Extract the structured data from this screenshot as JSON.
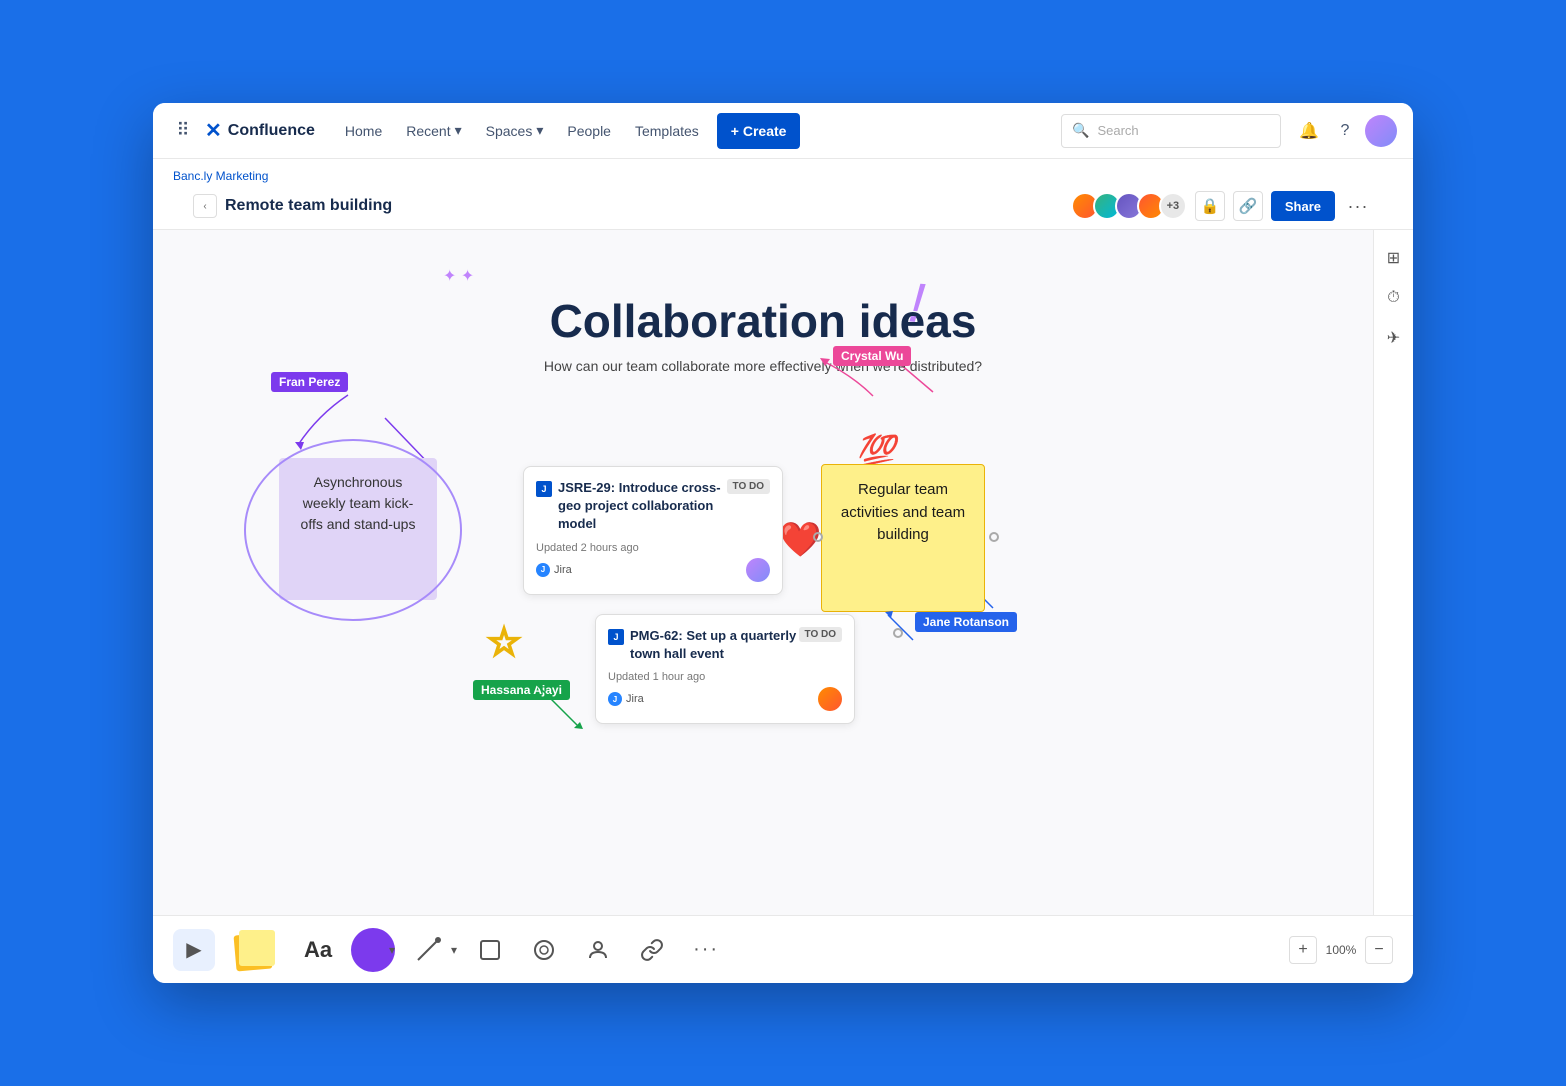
{
  "app": {
    "name": "Confluence",
    "logo_symbol": "✕"
  },
  "nav": {
    "home": "Home",
    "recent": "Recent",
    "spaces": "Spaces",
    "people": "People",
    "templates": "Templates",
    "create": "+ Create",
    "search_placeholder": "Search"
  },
  "breadcrumb": {
    "parent": "Banc.ly Marketing",
    "current": "Remote team building"
  },
  "toolbar": {
    "share": "Share"
  },
  "avatars": {
    "count_label": "+3"
  },
  "canvas": {
    "title": "Collaboration ideas",
    "subtitle": "How can our team collaborate more effectively when we're distributed?",
    "sticky_note_1": "Asynchronous weekly team kick-offs and stand-ups",
    "sticky_note_2": "Regular team activities and team building",
    "jira_card_1": {
      "id": "JSRE-29",
      "title": "Introduce cross-geo project collaboration model",
      "status": "TO DO",
      "updated": "Updated 2 hours ago",
      "source": "Jira"
    },
    "jira_card_2": {
      "id": "PMG-62",
      "title": "Set up a quarterly town hall event",
      "status": "TO DO",
      "updated": "Updated 1 hour ago",
      "source": "Jira"
    },
    "name_labels": {
      "label1": "Fran Perez",
      "label2": "Crystal Wu",
      "label3": "Jane Rotanson",
      "label4": "Hassana Ajayi"
    }
  },
  "zoom": {
    "level": "100%"
  }
}
